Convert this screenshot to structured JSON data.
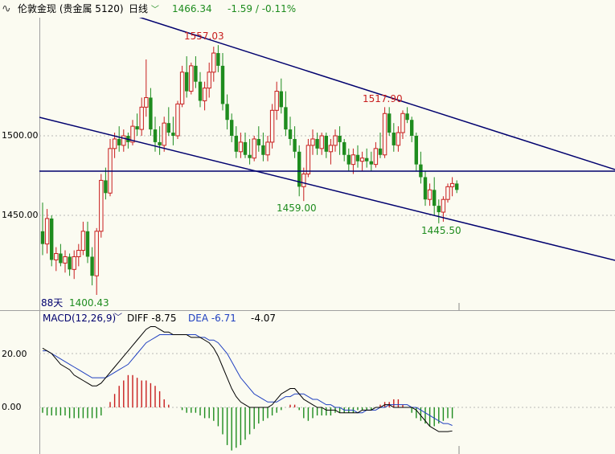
{
  "header": {
    "title": "伦敦金现 (贵金属 5120)",
    "period": "日线",
    "price": "1466.34",
    "change": "-1.59 / -0.11%"
  },
  "price_axis": [
    "1500.00",
    "1450.00"
  ],
  "annotations": {
    "high": "1557.03",
    "mid_high": "1517.90",
    "mid_low": "1459.00",
    "recent_low": "1445.50",
    "range_low": "1400.43",
    "days": "88天"
  },
  "macd": {
    "label": "MACD(12,26,9)",
    "diff": "DIFF -8.75",
    "dea": "DEA -6.71",
    "macd_value": "-4.07",
    "axis": [
      "20.00",
      "0.00"
    ]
  },
  "colors": {
    "up": "#c81e1e",
    "down": "#1e8c1e",
    "trendline": "#00006e",
    "diff_line": "#000000",
    "dea_line": "#2040c0",
    "background": "#fbfbf1"
  },
  "chart_data": {
    "type": "candlestick",
    "ylim": [
      1390,
      1590
    ],
    "candles": [
      [
        1440,
        1458,
        1425,
        1432
      ],
      [
        1432,
        1454,
        1426,
        1448
      ],
      [
        1448,
        1450,
        1418,
        1422
      ],
      [
        1422,
        1430,
        1415,
        1426
      ],
      [
        1426,
        1432,
        1418,
        1420
      ],
      [
        1420,
        1428,
        1414,
        1424
      ],
      [
        1424,
        1426,
        1412,
        1416
      ],
      [
        1416,
        1428,
        1410,
        1424
      ],
      [
        1424,
        1432,
        1418,
        1428
      ],
      [
        1428,
        1446,
        1425,
        1440
      ],
      [
        1440,
        1446,
        1420,
        1424
      ],
      [
        1424,
        1430,
        1406,
        1412
      ],
      [
        1412,
        1442,
        1400,
        1440
      ],
      [
        1440,
        1476,
        1436,
        1472
      ],
      [
        1472,
        1480,
        1460,
        1464
      ],
      [
        1464,
        1498,
        1462,
        1492
      ],
      [
        1492,
        1502,
        1486,
        1498
      ],
      [
        1498,
        1506,
        1490,
        1494
      ],
      [
        1494,
        1504,
        1490,
        1500
      ],
      [
        1500,
        1502,
        1492,
        1496
      ],
      [
        1496,
        1510,
        1494,
        1506
      ],
      [
        1506,
        1514,
        1500,
        1504
      ],
      [
        1504,
        1524,
        1500,
        1518
      ],
      [
        1518,
        1548,
        1512,
        1524
      ],
      [
        1524,
        1530,
        1500,
        1504
      ],
      [
        1504,
        1512,
        1490,
        1496
      ],
      [
        1496,
        1506,
        1488,
        1494
      ],
      [
        1494,
        1512,
        1490,
        1508
      ],
      [
        1508,
        1518,
        1500,
        1502
      ],
      [
        1502,
        1512,
        1494,
        1500
      ],
      [
        1500,
        1522,
        1498,
        1520
      ],
      [
        1520,
        1544,
        1518,
        1540
      ],
      [
        1540,
        1550,
        1524,
        1528
      ],
      [
        1528,
        1546,
        1526,
        1544
      ],
      [
        1544,
        1550,
        1530,
        1534
      ],
      [
        1534,
        1540,
        1518,
        1522
      ],
      [
        1522,
        1534,
        1516,
        1530
      ],
      [
        1530,
        1546,
        1524,
        1540
      ],
      [
        1540,
        1556,
        1534,
        1552
      ],
      [
        1552,
        1557,
        1540,
        1544
      ],
      [
        1544,
        1552,
        1516,
        1520
      ],
      [
        1520,
        1526,
        1504,
        1510
      ],
      [
        1510,
        1514,
        1496,
        1500
      ],
      [
        1500,
        1506,
        1486,
        1490
      ],
      [
        1490,
        1502,
        1486,
        1496
      ],
      [
        1496,
        1502,
        1486,
        1488
      ],
      [
        1488,
        1498,
        1482,
        1486
      ],
      [
        1486,
        1500,
        1484,
        1498
      ],
      [
        1498,
        1506,
        1490,
        1494
      ],
      [
        1494,
        1502,
        1484,
        1488
      ],
      [
        1488,
        1500,
        1484,
        1496
      ],
      [
        1496,
        1520,
        1492,
        1516
      ],
      [
        1516,
        1534,
        1510,
        1528
      ],
      [
        1528,
        1536,
        1514,
        1518
      ],
      [
        1518,
        1528,
        1500,
        1504
      ],
      [
        1504,
        1512,
        1494,
        1498
      ],
      [
        1498,
        1506,
        1486,
        1490
      ],
      [
        1490,
        1494,
        1462,
        1468
      ],
      [
        1468,
        1480,
        1459,
        1476
      ],
      [
        1476,
        1498,
        1474,
        1494
      ],
      [
        1494,
        1504,
        1488,
        1498
      ],
      [
        1498,
        1502,
        1488,
        1492
      ],
      [
        1492,
        1502,
        1488,
        1500
      ],
      [
        1500,
        1502,
        1486,
        1490
      ],
      [
        1490,
        1498,
        1482,
        1494
      ],
      [
        1494,
        1504,
        1490,
        1500
      ],
      [
        1500,
        1506,
        1488,
        1496
      ],
      [
        1496,
        1498,
        1484,
        1488
      ],
      [
        1488,
        1492,
        1478,
        1482
      ],
      [
        1482,
        1492,
        1476,
        1488
      ],
      [
        1488,
        1494,
        1480,
        1484
      ],
      [
        1484,
        1490,
        1478,
        1486
      ],
      [
        1486,
        1492,
        1480,
        1484
      ],
      [
        1484,
        1490,
        1478,
        1482
      ],
      [
        1482,
        1496,
        1480,
        1492
      ],
      [
        1492,
        1502,
        1486,
        1488
      ],
      [
        1488,
        1518,
        1486,
        1514
      ],
      [
        1514,
        1518,
        1500,
        1502
      ],
      [
        1502,
        1508,
        1490,
        1494
      ],
      [
        1494,
        1506,
        1490,
        1502
      ],
      [
        1502,
        1516,
        1498,
        1514
      ],
      [
        1514,
        1518,
        1508,
        1510
      ],
      [
        1510,
        1512,
        1496,
        1500
      ],
      [
        1500,
        1502,
        1478,
        1482
      ],
      [
        1482,
        1490,
        1470,
        1474
      ],
      [
        1474,
        1478,
        1456,
        1460
      ],
      [
        1460,
        1470,
        1456,
        1466
      ],
      [
        1466,
        1474,
        1450,
        1456
      ],
      [
        1456,
        1460,
        1445,
        1452
      ],
      [
        1452,
        1462,
        1446,
        1460
      ],
      [
        1460,
        1470,
        1458,
        1468
      ],
      [
        1468,
        1474,
        1462,
        1470
      ],
      [
        1470,
        1472,
        1464,
        1466
      ]
    ],
    "macd_range": [
      -15,
      30
    ],
    "diff_values": [
      22,
      21,
      20,
      18,
      16,
      15,
      14,
      12,
      11,
      10,
      9,
      8,
      8,
      9,
      11,
      13,
      15,
      17,
      19,
      21,
      23,
      25,
      27,
      29,
      30,
      30,
      29,
      28,
      28,
      27,
      27,
      27,
      27,
      26,
      26,
      26,
      25,
      24,
      22,
      19,
      15,
      11,
      7,
      4,
      2,
      1,
      0,
      0,
      0,
      0,
      0,
      1,
      3,
      5,
      6,
      7,
      7,
      5,
      3,
      2,
      1,
      0,
      0,
      -1,
      -1,
      -1,
      -2,
      -2,
      -2,
      -2,
      -2,
      -1,
      -1,
      -1,
      0,
      0,
      1,
      1,
      0,
      0,
      0,
      0,
      0,
      -1,
      -3,
      -5,
      -7,
      -8,
      -9,
      -9,
      -9,
      -8.75
    ],
    "dea_values": [
      21,
      21,
      20,
      19,
      18,
      17,
      16,
      15,
      14,
      13,
      12,
      11,
      11,
      11,
      11,
      12,
      13,
      14,
      15,
      16,
      18,
      20,
      22,
      24,
      25,
      26,
      27,
      27,
      27,
      27,
      27,
      27,
      27,
      27,
      27,
      26,
      26,
      25,
      25,
      24,
      22,
      20,
      17,
      14,
      11,
      9,
      7,
      5,
      4,
      3,
      2,
      2,
      2,
      3,
      4,
      4,
      5,
      5,
      5,
      4,
      3,
      3,
      2,
      1,
      1,
      0,
      0,
      -1,
      -1,
      -1,
      -2,
      -2,
      -1,
      -1,
      -1,
      0,
      0,
      1,
      1,
      1,
      1,
      1,
      0,
      0,
      -1,
      -2,
      -3,
      -4,
      -5,
      -6,
      -6,
      -6.71
    ],
    "macd_bars": [
      -2,
      -3,
      -3,
      -3,
      -3,
      -3,
      -4,
      -4,
      -4,
      -4,
      -4,
      -4,
      -4,
      -3,
      0,
      2,
      5,
      8,
      10,
      12,
      12,
      11,
      10,
      10,
      9,
      8,
      6,
      3,
      1,
      0,
      0,
      -1,
      -2,
      -2,
      -2,
      -3,
      -4,
      -4,
      -5,
      -7,
      -10,
      -14,
      -16,
      -15,
      -14,
      -12,
      -10,
      -8,
      -6,
      -5,
      -4,
      -3,
      -2,
      -1,
      0,
      1,
      1,
      -1,
      -4,
      -5,
      -4,
      -3,
      -3,
      -3,
      -3,
      -2,
      -2,
      -2,
      -2,
      -2,
      -1,
      -1,
      -1,
      -1,
      0,
      1,
      2,
      2,
      3,
      3,
      1,
      0,
      -2,
      -4,
      -5,
      -6,
      -7,
      -7,
      -6,
      -5,
      -4,
      -4.07
    ]
  }
}
